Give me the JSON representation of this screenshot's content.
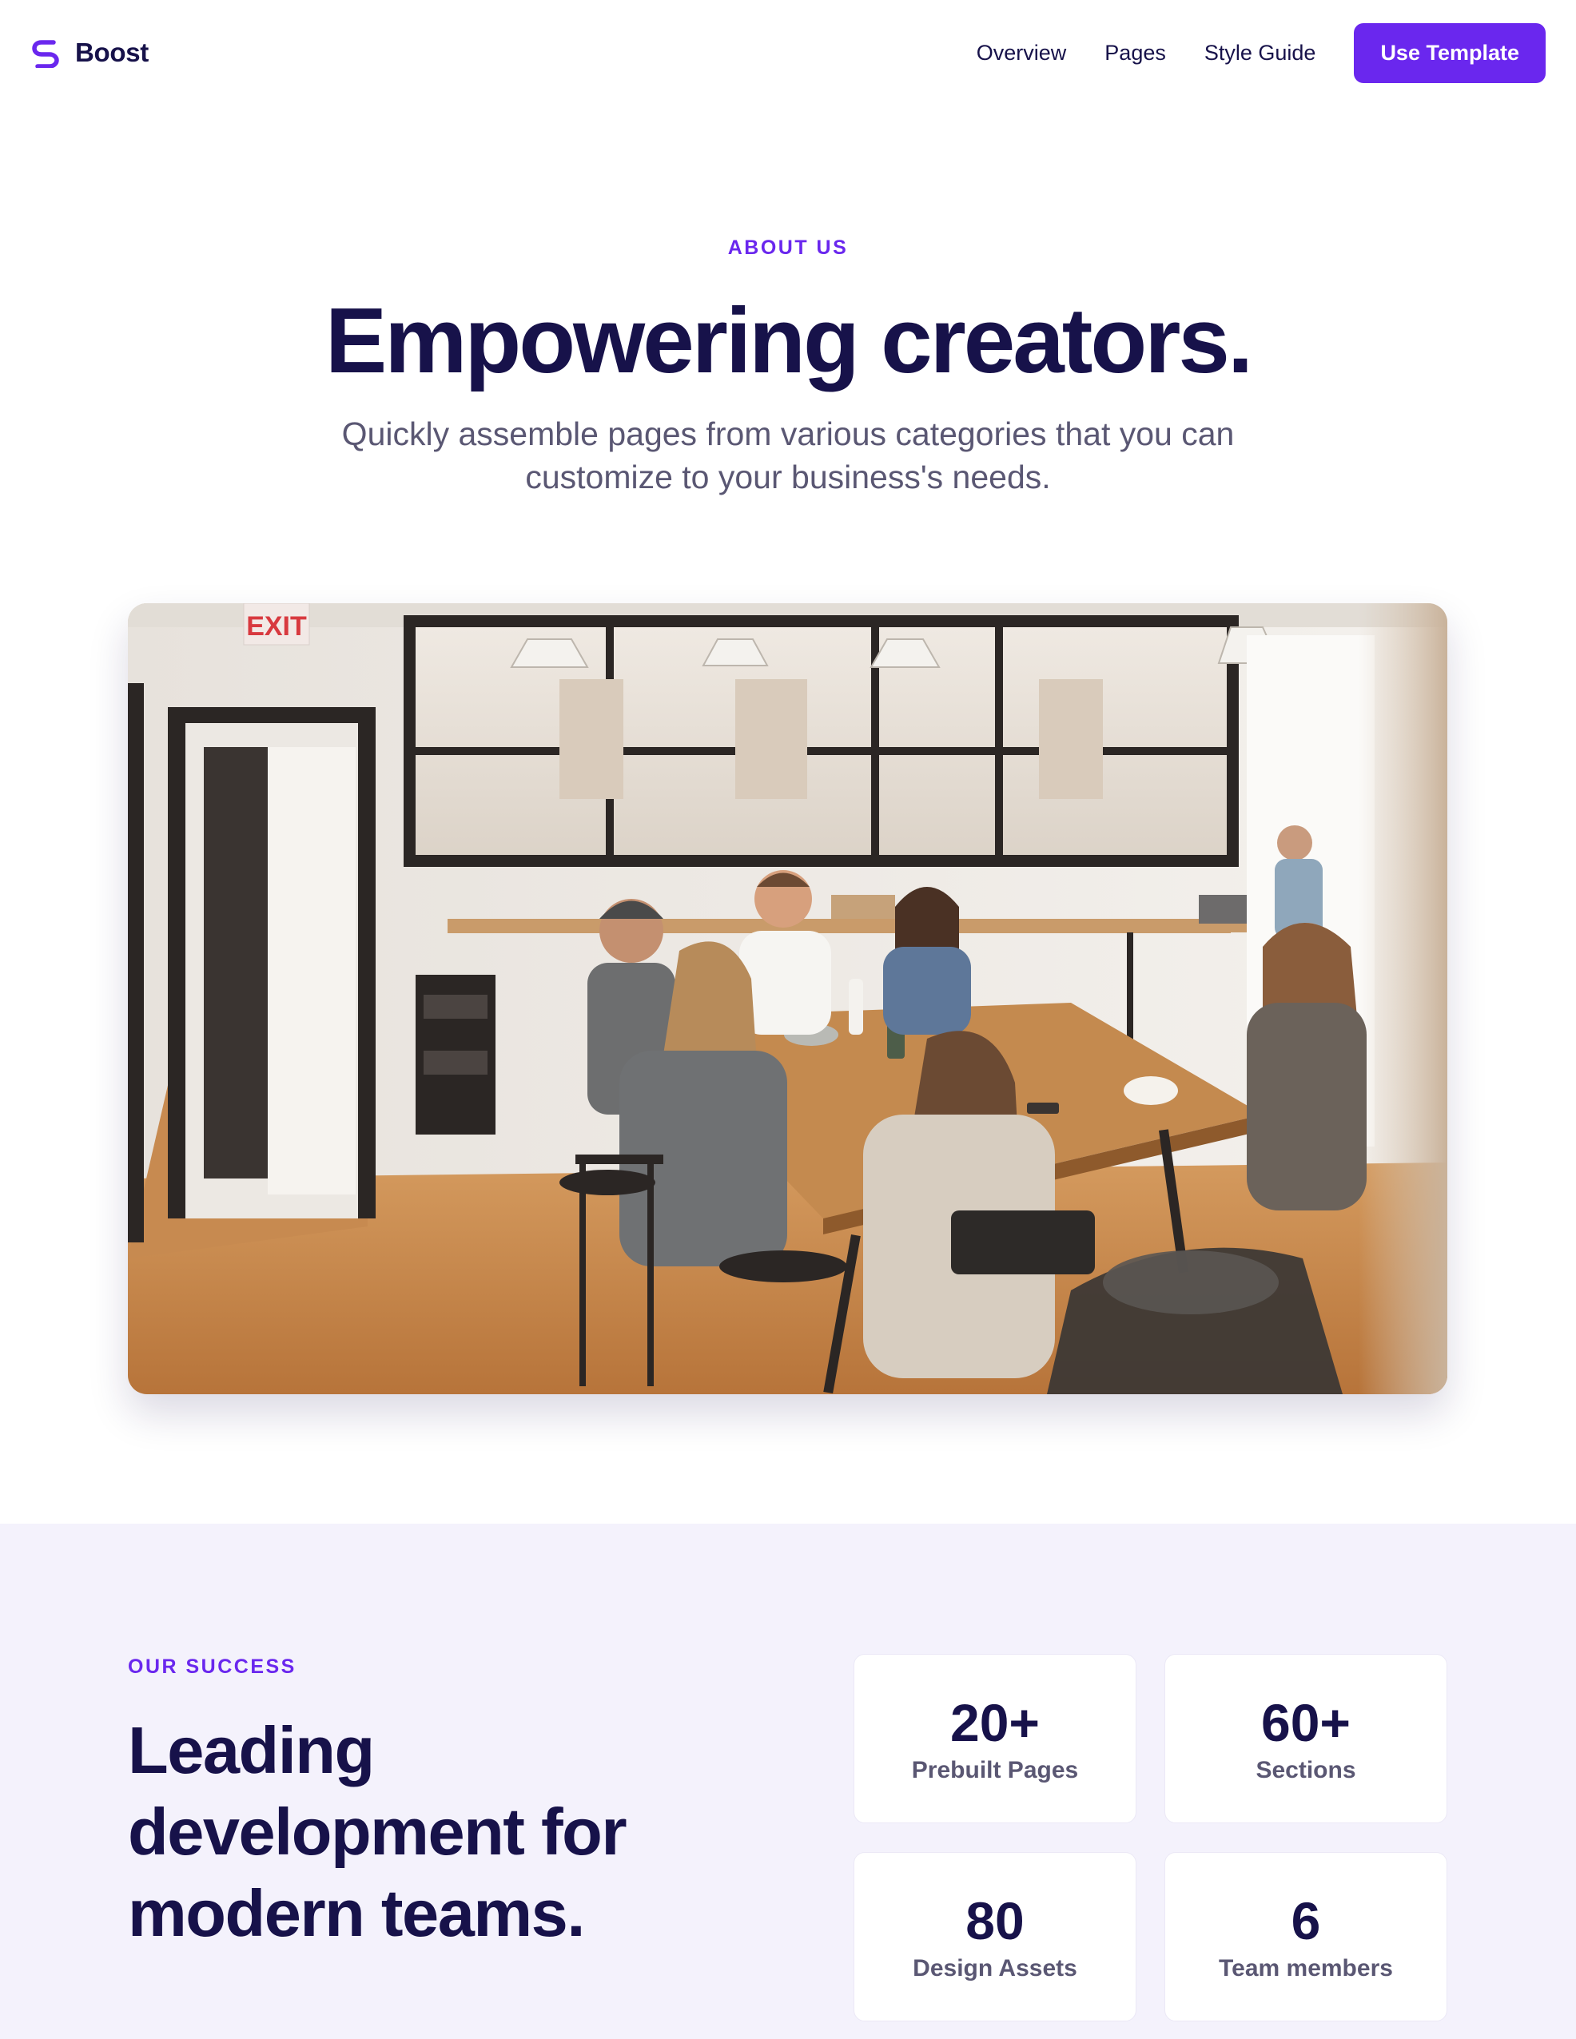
{
  "brand": {
    "name": "Boost",
    "accent": "#6a27ee",
    "text": "#17124a"
  },
  "nav": {
    "links": [
      {
        "label": "Overview"
      },
      {
        "label": "Pages"
      },
      {
        "label": "Style Guide"
      }
    ],
    "cta_label": "Use Template"
  },
  "hero": {
    "eyebrow": "ABOUT US",
    "title": "Empowering creators.",
    "subtitle": "Quickly assemble pages from various categories that you can customize to your business's needs."
  },
  "photo": {
    "sign_text": "EXIT"
  },
  "success": {
    "eyebrow": "OUR SUCCESS",
    "title": "Leading development for modern teams.",
    "background": "#f4f2fc",
    "stats": [
      {
        "value": "20+",
        "label": "Prebuilt Pages"
      },
      {
        "value": "60+",
        "label": "Sections"
      },
      {
        "value": "80",
        "label": "Design Assets"
      },
      {
        "value": "6",
        "label": "Team members"
      }
    ]
  }
}
